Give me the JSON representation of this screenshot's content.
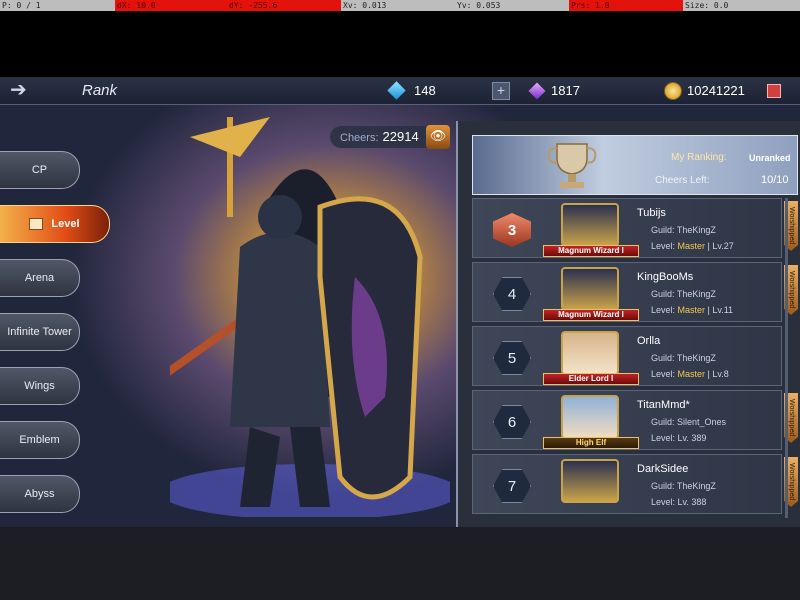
{
  "debug": {
    "p": "P: 0 / 1",
    "dx": "dX: 10.0",
    "dy": "dY: -255.6",
    "xv": "Xv: 0.013",
    "yv": "Yv: 0.053",
    "prs": "Prs: 1.0",
    "size": "Size: 0.0"
  },
  "topbar": {
    "title": "Rank",
    "diamonds": "148",
    "gems": "1817",
    "coins": "10241221"
  },
  "menu": [
    {
      "label": "CP"
    },
    {
      "label": "Level"
    },
    {
      "label": "Arena"
    },
    {
      "label": "Infinite Tower"
    },
    {
      "label": "Wings"
    },
    {
      "label": "Emblem"
    },
    {
      "label": "Abyss"
    }
  ],
  "cheers": {
    "label": "Cheers:",
    "value": "22914"
  },
  "ranking": {
    "my_label": "My Ranking:",
    "my_value": "Unranked",
    "cheers_left_label": "Cheers Left:",
    "cheers_left_value": "10/10"
  },
  "players": [
    {
      "rank": "3",
      "name": "Tubijs",
      "guild": "Guild: TheKingZ",
      "level_prefix": "Level: ",
      "level_tier": "Master",
      "level_rest": " | Lv.27",
      "class": "Magnum Wizard I",
      "worship": "Worshipped"
    },
    {
      "rank": "4",
      "name": "KingBooMs",
      "guild": "Guild: TheKingZ",
      "level_prefix": "Level: ",
      "level_tier": "Master",
      "level_rest": " | Lv.11",
      "class": "Magnum Wizard I",
      "worship": "Worshipped"
    },
    {
      "rank": "5",
      "name": "Orlla",
      "guild": "Guild: TheKingZ",
      "level_prefix": "Level: ",
      "level_tier": "Master",
      "level_rest": " | Lv.8",
      "class": "Elder Lord I",
      "worship": ""
    },
    {
      "rank": "6",
      "name": "TitanMmd*",
      "guild": "Guild: Silent_Ones",
      "level_prefix": "Level: ",
      "level_tier": "",
      "level_rest": "Lv. 389",
      "class": "High Elf",
      "worship": "Worshipped"
    },
    {
      "rank": "7",
      "name": "DarkSidee",
      "guild": "Guild: TheKingZ",
      "level_prefix": "Level: ",
      "level_tier": "",
      "level_rest": "Lv. 388",
      "class": "",
      "worship": "Worshipped"
    }
  ],
  "colors": {
    "accent_orange": "#e24d16",
    "gold": "#f1c84a",
    "panel_bg": "#2a2f3c"
  }
}
